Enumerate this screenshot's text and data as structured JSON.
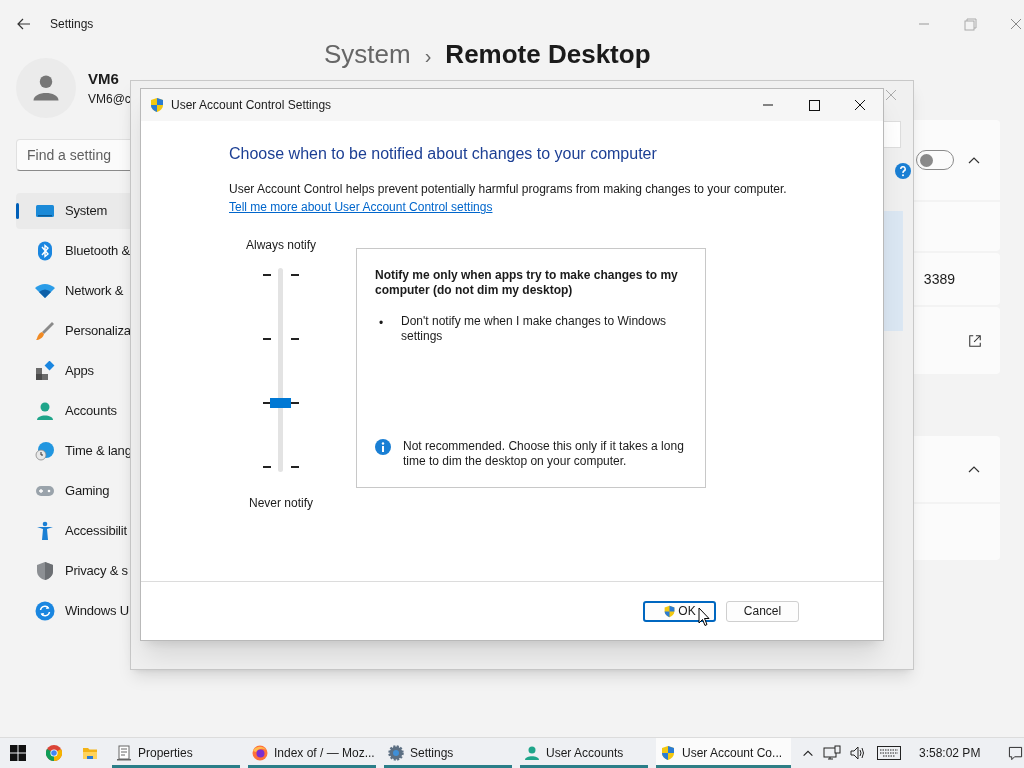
{
  "settings": {
    "title": "Settings",
    "user": {
      "name": "VM6",
      "email": "VM6@c"
    },
    "search": {
      "placeholder": "Find a setting"
    },
    "nav": [
      {
        "label": "System",
        "selected": true
      },
      {
        "label": "Bluetooth &",
        "selected": false
      },
      {
        "label": "Network &",
        "selected": false
      },
      {
        "label": "Personaliza",
        "selected": false
      },
      {
        "label": "Apps",
        "selected": false
      },
      {
        "label": "Accounts",
        "selected": false
      },
      {
        "label": "Time & lang",
        "selected": false
      },
      {
        "label": "Gaming",
        "selected": false
      },
      {
        "label": "Accessibilit",
        "selected": false
      },
      {
        "label": "Privacy & s",
        "selected": false
      },
      {
        "label": "Windows U",
        "selected": false
      }
    ],
    "breadcrumb": {
      "parent": "System",
      "separator": "›",
      "current": "Remote Desktop"
    },
    "remote_desktop": {
      "on": false,
      "expanded": true
    },
    "port": "3389",
    "advanced": {
      "expanded": true
    }
  },
  "dialog": {
    "title": "User Account Control Settings",
    "heading": "Choose when to be notified about changes to your computer",
    "description": "User Account Control helps prevent potentially harmful programs from making changes to your computer.",
    "link": "Tell me more about User Account Control settings",
    "slider": {
      "top_label": "Always notify",
      "bottom_label": "Never notify",
      "level": 0.3333
    },
    "info": {
      "title": "Notify me only when apps try to make changes to my computer (do not dim my desktop)",
      "bullet": "•",
      "bullet_text": "Don't notify me when I make changes to Windows settings",
      "note": "Not recommended. Choose this only if it takes a long time to dim the desktop on your computer."
    },
    "buttons": [
      {
        "label": "OK",
        "shield": true,
        "default": true
      },
      {
        "label": "Cancel",
        "shield": false,
        "default": false
      }
    ]
  },
  "taskbar": {
    "apps": [
      {
        "label": "Properties",
        "selected": false
      },
      {
        "label": "Index of / — Moz...",
        "selected": false
      },
      {
        "label": "Settings",
        "selected": false
      },
      {
        "label": "User Accounts",
        "selected": false
      },
      {
        "label": "User Account Co...",
        "selected": true
      }
    ],
    "clock": "3:58:02 PM"
  }
}
